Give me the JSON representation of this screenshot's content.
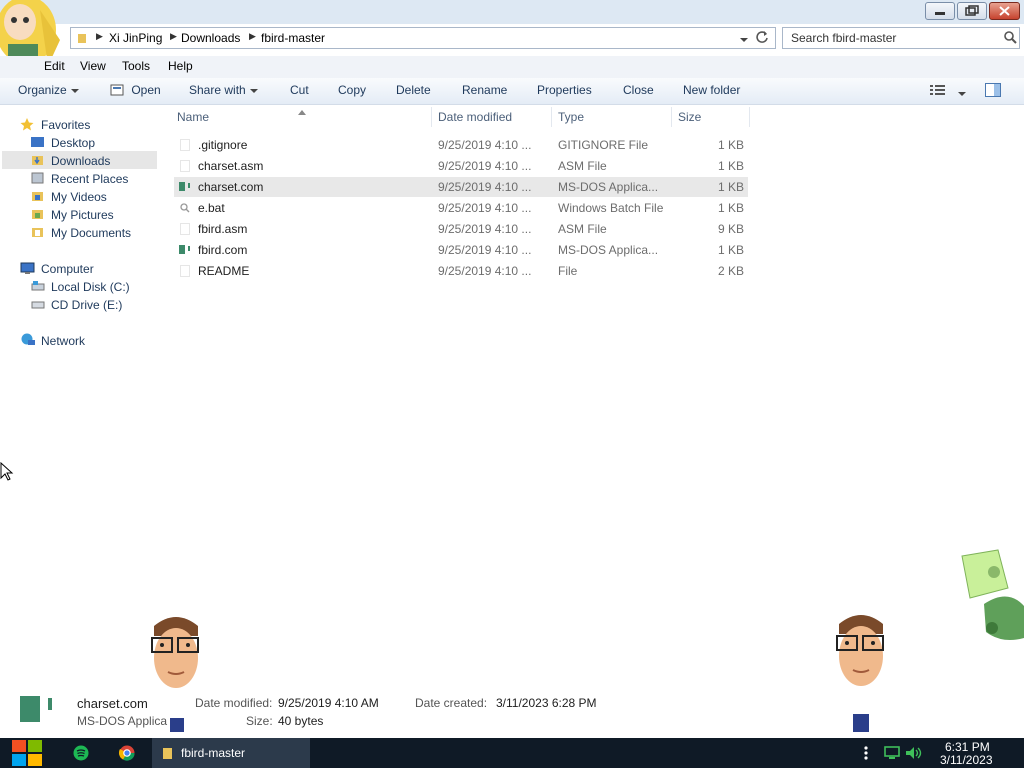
{
  "address": {
    "crumbs": [
      "Xi JinPing",
      "Downloads",
      "fbird-master"
    ]
  },
  "search": {
    "placeholder": "Search fbird-master"
  },
  "menu": [
    "Edit",
    "View",
    "Tools",
    "Help"
  ],
  "toolbar": {
    "organize": "Organize",
    "open": "Open",
    "share_with": "Share with",
    "cut": "Cut",
    "copy": "Copy",
    "delete": "Delete",
    "rename": "Rename",
    "properties": "Properties",
    "close": "Close",
    "new_folder": "New folder"
  },
  "nav": {
    "favorites": "Favorites",
    "favorites_items": [
      "Desktop",
      "Downloads",
      "Recent Places",
      "My Videos",
      "My Pictures",
      "My Documents"
    ],
    "computer": "Computer",
    "computer_items": [
      "Local Disk (C:)",
      "CD Drive (E:)"
    ],
    "network": "Network"
  },
  "columns": {
    "name": "Name",
    "date": "Date modified",
    "type": "Type",
    "size": "Size"
  },
  "files": [
    {
      "name": ".gitignore",
      "date": "9/25/2019 4:10 ...",
      "type": "GITIGNORE File",
      "size": "1 KB"
    },
    {
      "name": "charset.asm",
      "date": "9/25/2019 4:10 ...",
      "type": "ASM File",
      "size": "1 KB"
    },
    {
      "name": "charset.com",
      "date": "9/25/2019 4:10 ...",
      "type": "MS-DOS Applica...",
      "size": "1 KB"
    },
    {
      "name": "e.bat",
      "date": "9/25/2019 4:10 ...",
      "type": "Windows Batch File",
      "size": "1 KB"
    },
    {
      "name": "fbird.asm",
      "date": "9/25/2019 4:10 ...",
      "type": "ASM File",
      "size": "9 KB"
    },
    {
      "name": "fbird.com",
      "date": "9/25/2019 4:10 ...",
      "type": "MS-DOS Applica...",
      "size": "1 KB"
    },
    {
      "name": "README",
      "date": "9/25/2019 4:10 ...",
      "type": "File",
      "size": "2 KB"
    }
  ],
  "details": {
    "name": "charset.com",
    "type": "MS-DOS Applica",
    "date_modified_label": "Date modified:",
    "date_modified": "9/25/2019 4:10 AM",
    "date_created_label": "Date created:",
    "date_created": "3/11/2023 6:28 PM",
    "size_label": "Size:",
    "size": "40 bytes"
  },
  "taskbar": {
    "window_label": "fbird-master",
    "time": "6:31 PM",
    "date": "3/11/2023"
  },
  "colors": {
    "selection": "#e8e8e8",
    "hover_nav": "#e6e6e6",
    "taskbar": "#0f1a26"
  }
}
